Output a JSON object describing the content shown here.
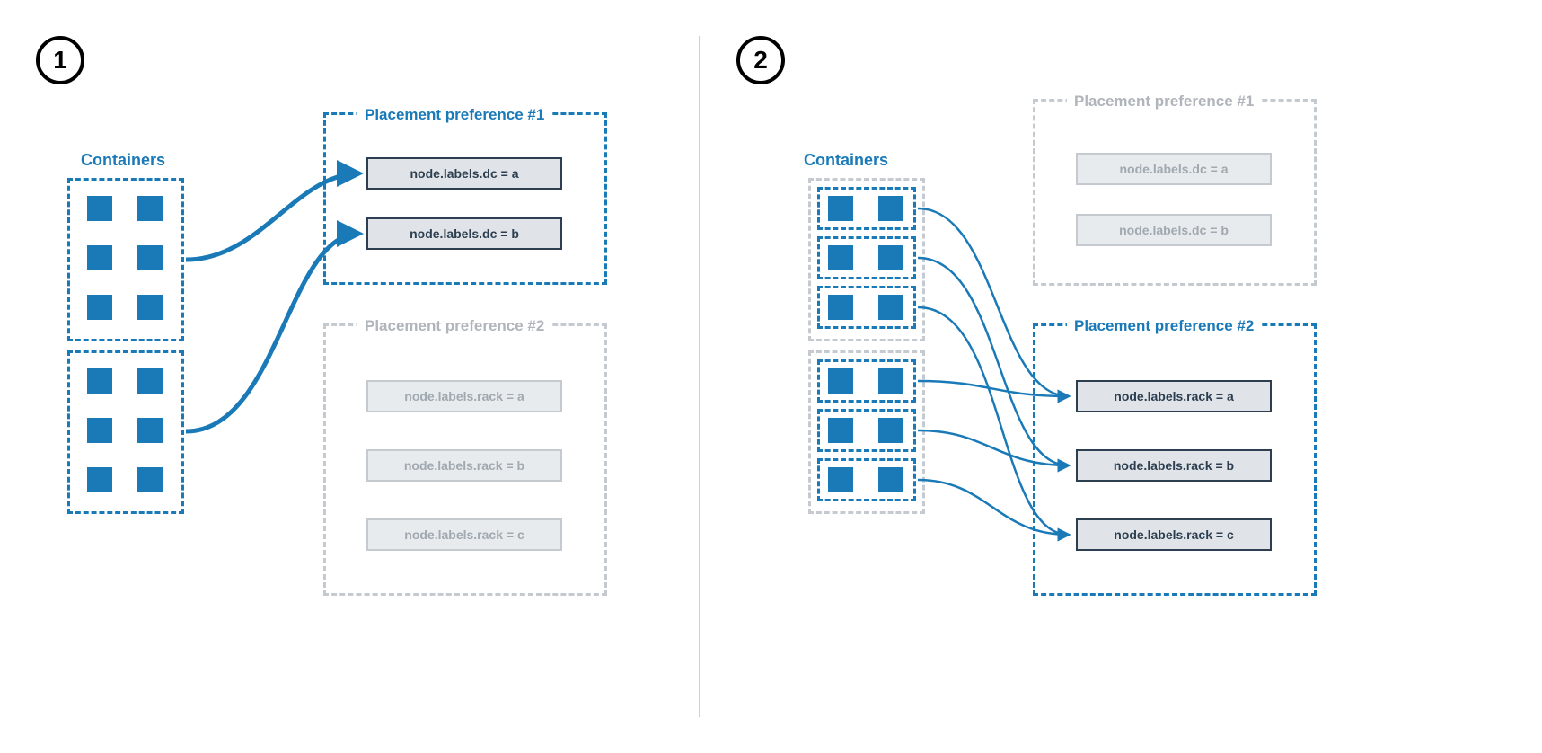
{
  "steps": {
    "one": "1",
    "two": "2"
  },
  "labels": {
    "containers": "Containers",
    "pref1": "Placement preference #1",
    "pref2": "Placement preference #2"
  },
  "nodes": {
    "dc_a": "node.labels.dc = a",
    "dc_b": "node.labels.dc = b",
    "rack_a": "node.labels.rack = a",
    "rack_b": "node.labels.rack = b",
    "rack_c": "node.labels.rack = c"
  },
  "colors": {
    "blue": "#1A7AB8",
    "gray": "#b0b5bb"
  }
}
